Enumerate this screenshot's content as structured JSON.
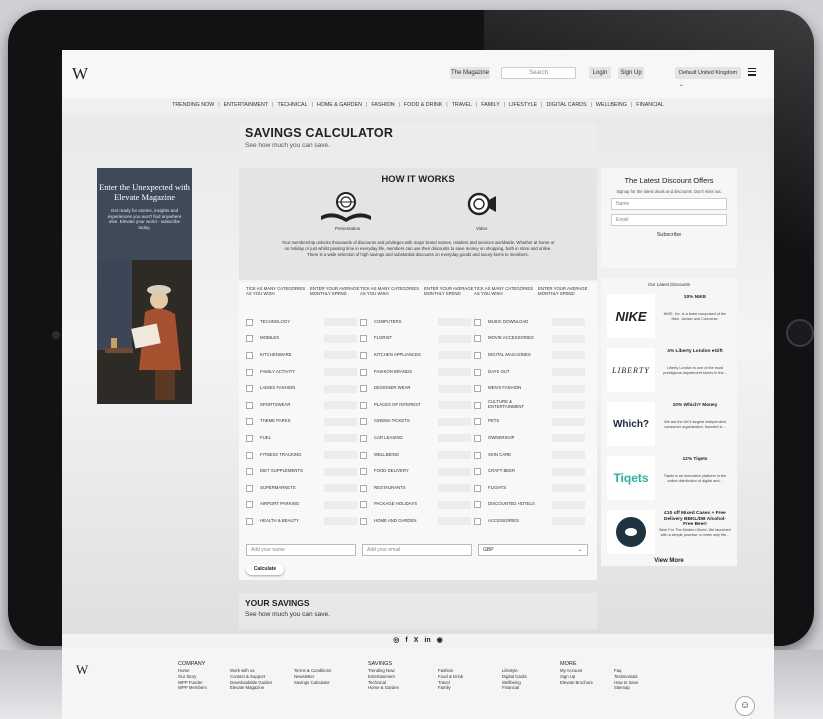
{
  "header": {
    "logo": "W",
    "magazine_btn": "The Magazine",
    "search_placeholder": "Search",
    "login": "Login",
    "signup": "Sign Up",
    "region": "Default United Kingdom",
    "nav": [
      "TRENDING NOW",
      "ENTERTAINMENT",
      "TECHNICAL",
      "HOME & GARDEN",
      "FASHION",
      "FOOD & DRINK",
      "TRAVEL",
      "FAMILY",
      "LIFESTYLE",
      "DIGITAL CARDS",
      "WELLBEING",
      "FINANCIAL"
    ]
  },
  "page": {
    "title": "SAVINGS CALCULATOR",
    "subtitle": "See how much you can save."
  },
  "how": {
    "title": "HOW IT WORKS",
    "presentation_caption": "Presentation",
    "video_caption": "Video",
    "text": "Your membership unlocks thousands of discounts and privileges with major brand names, retailers and services worldwide. Whether at home or on holiday or just whilst passing time in everyday life, members can use their discounts to save money on shopping, both in store and online. There is a wide selection of high savings and substantial discounts on everyday goods and luxury items to members."
  },
  "calc": {
    "head_tick": "TICK AS MANY CATEGORIES AS YOU WISH",
    "head_enter": "ENTER YOUR AVERAGE MONTHLY SPEND",
    "col1": [
      "TECHNOLOGY",
      "MOBILES",
      "KITCHENWARE",
      "FAMILY ACTIVITY",
      "LADIES FASHION",
      "SPORTSWEAR",
      "THEME PARKS",
      "FUEL",
      "FITNESS TRACKING",
      "DIET SUPPLEMENTS",
      "SUPERMARKETS",
      "AIRPORT PARKING",
      "HEALTH & BEAUTY"
    ],
    "col2": [
      "COMPUTERS",
      "FLORIST",
      "KITCHEN APPLIANCES",
      "FASHION BRANDS",
      "DESIGNER WEAR",
      "PLACES OF INTEREST",
      "CINEMA TICKETS",
      "CAR LEASING",
      "WELLBEING",
      "FOOD DELIVERY",
      "RESTAURANTS",
      "PACKAGE HOLIDAYS",
      "HOME AND GARDEN"
    ],
    "col3": [
      "MUSIC DOWNLOAD",
      "MOVIE ACCESSORIES",
      "DIGITAL MAGAZINES",
      "DAYS OUT",
      "MEN'S FASHION",
      "CULTURE & ENTERTAINMENT",
      "PETS",
      "OWNERSHIP",
      "SKIN CARE",
      "CRAFT BEER",
      "FLIGHTS",
      "DISCOUNTED HOTELS",
      "ACCESSORIES"
    ],
    "name_placeholder": "Add your name",
    "email_placeholder": "Add your email",
    "currency": "GBP",
    "calculate_btn": "Calculate"
  },
  "savings": {
    "title": "YOUR SAVINGS",
    "subtitle": "See how much you can save."
  },
  "ad": {
    "title": "Enter the Unexpected with Elevate Magazine",
    "text": "Get ready for stories, insights and experiences you won't find anywhere else. Elevate your world - subscribe today."
  },
  "signup": {
    "title": "The Latest Discount Offers",
    "sub": "Signup for the latest deals and discounts. Don't miss out.",
    "name": "Name",
    "email": "Email",
    "subscribe": "Subscribe"
  },
  "offers": {
    "head": "Our Latest Discounts",
    "items": [
      {
        "logo": "NIKE",
        "title": "10% NIKE",
        "desc": "NIKE, Inc. is a team comprised of the Nike, Jordan and Converse."
      },
      {
        "logo": "LIBERTY",
        "title": "4% Liberty London eGift",
        "desc": "Liberty London is one of the most prestigious department stores in the..."
      },
      {
        "logo": "Which?",
        "title": "10% Which? Money",
        "desc": "We are the UK's largest independent consumer organisation, founded in..."
      },
      {
        "logo": "Tiqets",
        "title": "12% Tiqets",
        "desc": "Tiqets is an innovative platform in the online distribution of digital and..."
      },
      {
        "logo": "",
        "title": "£10 off Mixed Cases + Free Delivery BBKL/DB Alcohol-Free Beer!",
        "desc": "Beer For The Modern World. We launched with a simple promise: to brew only the..."
      }
    ],
    "view_more": "View More"
  },
  "social": [
    "◎",
    "f",
    "X",
    "in",
    "◉"
  ],
  "footer": {
    "logo": "W",
    "company_head": "COMPANY",
    "company1": [
      "Home",
      "Our Story",
      "WPP Funder",
      "WPP Members"
    ],
    "company2": [
      "Work with us",
      "Contact & Support",
      "Downloadable Guides",
      "Elevate Magazine"
    ],
    "company3": [
      "Terms & Conditions",
      "Newsletter",
      "Savings Calculator"
    ],
    "savings_head": "SAVINGS",
    "savings1": [
      "Trending Now",
      "Entertainment",
      "Technical",
      "Home & Garden"
    ],
    "savings2": [
      "Fashion",
      "Food & Drink",
      "Travel",
      "Family"
    ],
    "savings3": [
      "Lifestyle",
      "Digital Cards",
      "Wellbeing",
      "Financial"
    ],
    "more_head": "MORE",
    "more1": [
      "My Account",
      "Sign Up",
      "Elevate Brochure"
    ],
    "more2": [
      "Faq",
      "Testimonials",
      "How to Save",
      "Sitemap"
    ]
  },
  "colors": {
    "accent": "#1a1a1a",
    "nike_bg": "#ffffff",
    "tiqets": "#26b5a0",
    "ad_bg": "#3e4a58"
  }
}
